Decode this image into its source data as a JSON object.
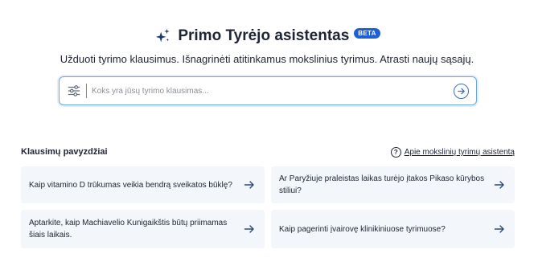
{
  "header": {
    "title": "Primo Tyrėjo asistentas",
    "badge": "BETA",
    "subtitle": "Užduoti tyrimo klausimus. Išnagrinėti atitinkamus mokslinius tyrimus. Atrasti naujų sąsajų."
  },
  "search": {
    "placeholder": "Koks yra jūsų tyrimo klausimas...",
    "value": ""
  },
  "examples": {
    "title": "Klausimų pavyzdžiai",
    "about_link": "Apie mokslinių tyrimų asistentą",
    "items": [
      "Kaip vitamino D trūkumas veikia bendrą sveikatos būklę?",
      "Ar Paryžiuje praleistas laikas turėjo įtakos Pikaso kūrybos stiliui?",
      "Aptarkite, kaip Machiavelio Kunigaikštis būtų priimamas šiais laikais.",
      "Kaip pagerinti įvairovę klinikiniuose tyrimuose?"
    ]
  },
  "icons": {
    "sparkle": "sparkle-icon",
    "filter": "filter-icon",
    "submit": "arrow-right-circle-icon",
    "help": "question-circle-icon",
    "card_arrow": "arrow-right-icon"
  },
  "colors": {
    "accent": "#1f5fd6",
    "brand_navy": "#1d2433",
    "search_border": "#6ba7e6",
    "card_bg": "#f3f6fa"
  }
}
